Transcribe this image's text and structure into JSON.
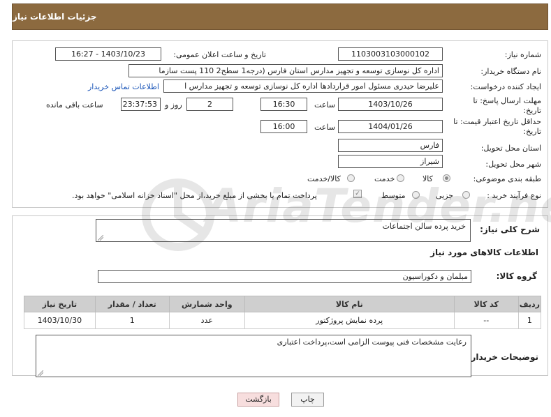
{
  "header": {
    "title": "جزئیات اطلاعات نیاز"
  },
  "form": {
    "need_number_label": "شماره نیاز:",
    "need_number": "1103003103000102",
    "announce_datetime_label": "تاریخ و ساعت اعلان عمومی:",
    "announce_datetime": "1403/10/23 - 16:27",
    "buyer_org_label": "نام دستگاه خریدار:",
    "buyer_org": "اداره کل نوسازی   توسعه و تجهیز مدارس استان فارس (درجه1  سطح2  110 پست سازما",
    "requester_label": "ایجاد کننده درخواست:",
    "requester": "علیرضا حیدری مسئول امور قراردادها اداره کل نوسازی   توسعه و تجهیز مدارس ا",
    "contact_link": "اطلاعات تماس خریدار",
    "reply_deadline_label": "مهلت ارسال پاسخ: تا",
    "reply_deadline_label2": "تاریخ:",
    "reply_date": "1403/10/26",
    "time_label": "ساعت",
    "reply_time": "16:30",
    "days": "2",
    "days_label": "روز و",
    "remaining_time": "23:37:53",
    "remaining_label": "ساعت باقی مانده",
    "price_validity_label": "حداقل تاریخ اعتبار قیمت: تا",
    "price_validity_label2": "تاریخ:",
    "validity_date": "1404/01/26",
    "validity_time": "16:00",
    "province_label": "استان محل تحویل:",
    "province": "فارس",
    "city_label": "شهر محل تحویل:",
    "city": "شیراز",
    "category_label": "طبقه بندی موضوعی:",
    "category_options": [
      "کالا",
      "خدمت",
      "کالا/خدمت"
    ],
    "process_label": "نوع فرآیند خرید :",
    "process_options": [
      "جزیی",
      "متوسط"
    ],
    "payment_note": "پرداخت تمام یا بخشی از مبلغ خرید،از محل \"اسناد خزانه اسلامی\" خواهد بود."
  },
  "description": {
    "label": "شرح کلی نیاز:",
    "value": "خرید پرده سالن اجتماعات",
    "goods_info_title": "اطلاعات کالاهای مورد نیاز",
    "group_label": "گروه کالا:",
    "group_value": "مبلمان و دکوراسیون"
  },
  "table": {
    "headers": [
      "ردیف",
      "کد کالا",
      "نام کالا",
      "واحد شمارش",
      "تعداد / مقدار",
      "تاریخ نیاز"
    ],
    "rows": [
      [
        "1",
        "--",
        "پرده نمایش پروژکتور",
        "عدد",
        "1",
        "1403/10/30"
      ]
    ]
  },
  "buyer_notes": {
    "label": "توضیحات خریدار:",
    "value": "رعایت مشخصات فنی پیوست الزامی است،پرداخت اعتباری"
  },
  "buttons": {
    "print": "چاپ",
    "back": "بازگشت"
  },
  "watermark": {
    "text": "AriaTender.net"
  },
  "colors": {
    "header_bg": "#8c6a3f",
    "link": "#1a55b8",
    "back_btn_bg": "#f7dede",
    "table_header_bg": "#cfcfcf"
  }
}
